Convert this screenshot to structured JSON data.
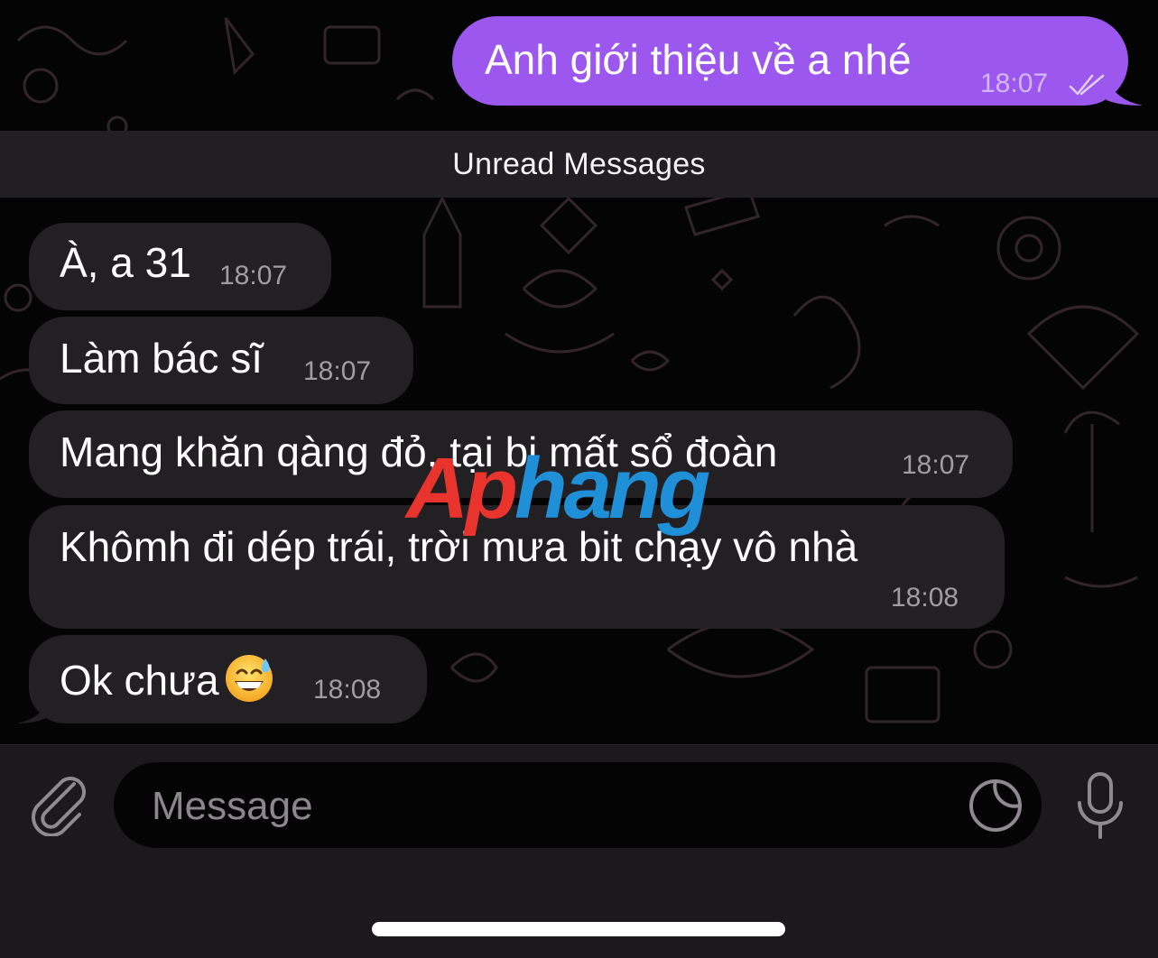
{
  "outgoing_messages": [
    {
      "text": "Anh giới thiệu về a nhé",
      "time": "18:07",
      "status_icon": "double-check-icon"
    }
  ],
  "unread_divider": "Unread Messages",
  "incoming_messages": [
    {
      "text": "À, a 31",
      "time": "18:07"
    },
    {
      "text": "Làm bác sĩ",
      "time": "18:07"
    },
    {
      "text": "Mang khăn qàng đỏ, tại bị mất sổ đoàn",
      "time": "18:07"
    },
    {
      "text": "Khômh đi dép trái, trời mưa bit chạy vô nhà",
      "time": "18:08"
    },
    {
      "text": "Ok chưa",
      "emoji": "grinning-sweat-emoji",
      "time": "18:08"
    }
  ],
  "watermark": {
    "part1": "Ap",
    "part2": "hang"
  },
  "composer": {
    "placeholder": "Message",
    "attach_icon": "paperclip-icon",
    "sticker_icon": "sticker-icon",
    "mic_icon": "microphone-icon"
  },
  "colors": {
    "outgoing_bubble": "#9b57ee",
    "incoming_bubble": "#232024",
    "divider_bar": "#221f24",
    "composer_bar": "#1b191c"
  }
}
